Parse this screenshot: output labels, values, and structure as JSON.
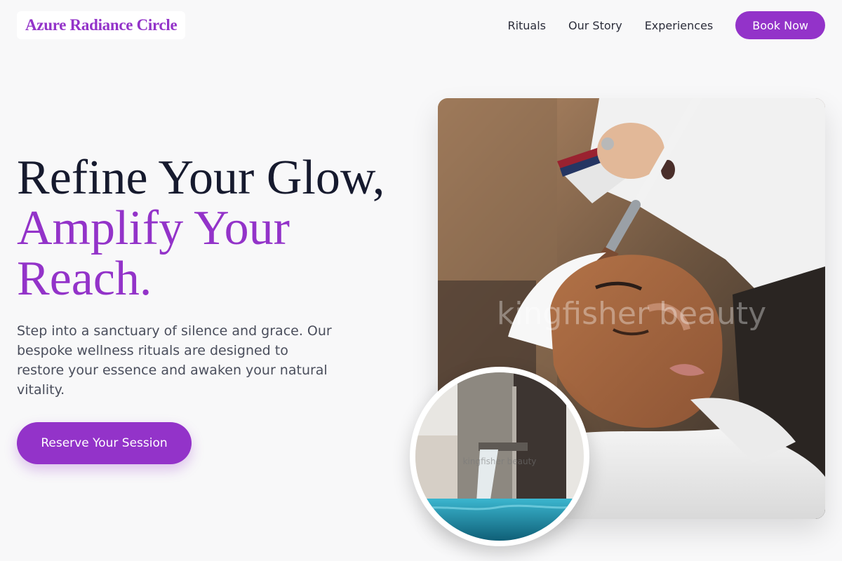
{
  "brand": {
    "name": "Azure Radiance Circle"
  },
  "nav": {
    "links": [
      "Rituals",
      "Our Story",
      "Experiences"
    ],
    "cta_label": "Book Now"
  },
  "hero": {
    "headline_line1": "Refine Your Glow,",
    "headline_accent": "Amplify Your Reach.",
    "lead": "Step into a sanctuary of silence and grace. Our bespoke wellness rituals are designed to restore your essence and awaken your natural vitality.",
    "cta_label": "Reserve Your Session"
  },
  "images": {
    "main_watermark": "kingfisher beauty",
    "circle_watermark": "kingfisher beauty"
  },
  "colors": {
    "accent": "#9333c9",
    "background": "#f8f8f9",
    "heading": "#161a2e",
    "body_text": "#4a4e5c"
  }
}
